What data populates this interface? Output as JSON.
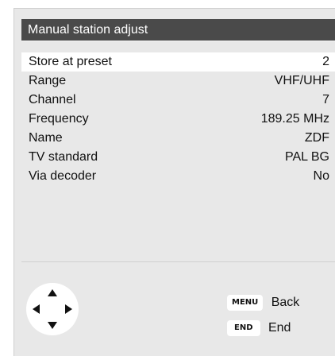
{
  "header": {
    "title": "Manual station adjust"
  },
  "rows": [
    {
      "label": "Store at preset",
      "value": "2"
    },
    {
      "label": "Range",
      "value": "VHF/UHF"
    },
    {
      "label": "Channel",
      "value": "7"
    },
    {
      "label": "Frequency",
      "value": "189.25 MHz"
    },
    {
      "label": "Name",
      "value": "ZDF"
    },
    {
      "label": "TV standard",
      "value": "PAL BG"
    },
    {
      "label": "Via decoder",
      "value": "No"
    }
  ],
  "footer": {
    "nav_icon": "navigation-arrows-icon",
    "menu": {
      "key": "MENU",
      "label": "Back"
    },
    "end": {
      "key": "END",
      "label": "End"
    }
  },
  "colors": {
    "title_bg": "#4a4a4a",
    "panel_bg": "#e8e8e8",
    "selected_bg": "#ffffff"
  }
}
